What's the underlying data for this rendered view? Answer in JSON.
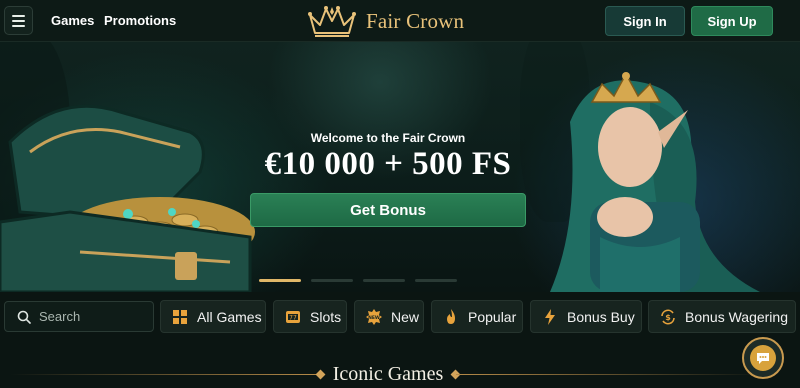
{
  "header": {
    "nav": {
      "games": "Games",
      "promotions": "Promotions"
    },
    "brand": "Fair Crown",
    "sign_in": "Sign In",
    "sign_up": "Sign Up"
  },
  "hero": {
    "welcome": "Welcome to the Fair Crown",
    "offer": "€10 000 + 500 FS",
    "cta": "Get Bonus",
    "slides_total": 4,
    "slide_active": 1
  },
  "search": {
    "placeholder": "Search"
  },
  "categories": [
    {
      "label": "All Games",
      "icon": "grid-icon"
    },
    {
      "label": "Slots",
      "icon": "slot-machine-icon"
    },
    {
      "label": "New",
      "icon": "new-badge-icon"
    },
    {
      "label": "Popular",
      "icon": "flame-icon"
    },
    {
      "label": "Bonus Buy",
      "icon": "lightning-icon"
    },
    {
      "label": "Bonus Wagering",
      "icon": "dollar-exchange-icon"
    }
  ],
  "section": {
    "title": "Iconic Games"
  },
  "colors": {
    "background": "#0b1512",
    "gold": "#e8c27a",
    "primary_green": "#1f6b46",
    "sign_in_bg": "#173a36"
  }
}
